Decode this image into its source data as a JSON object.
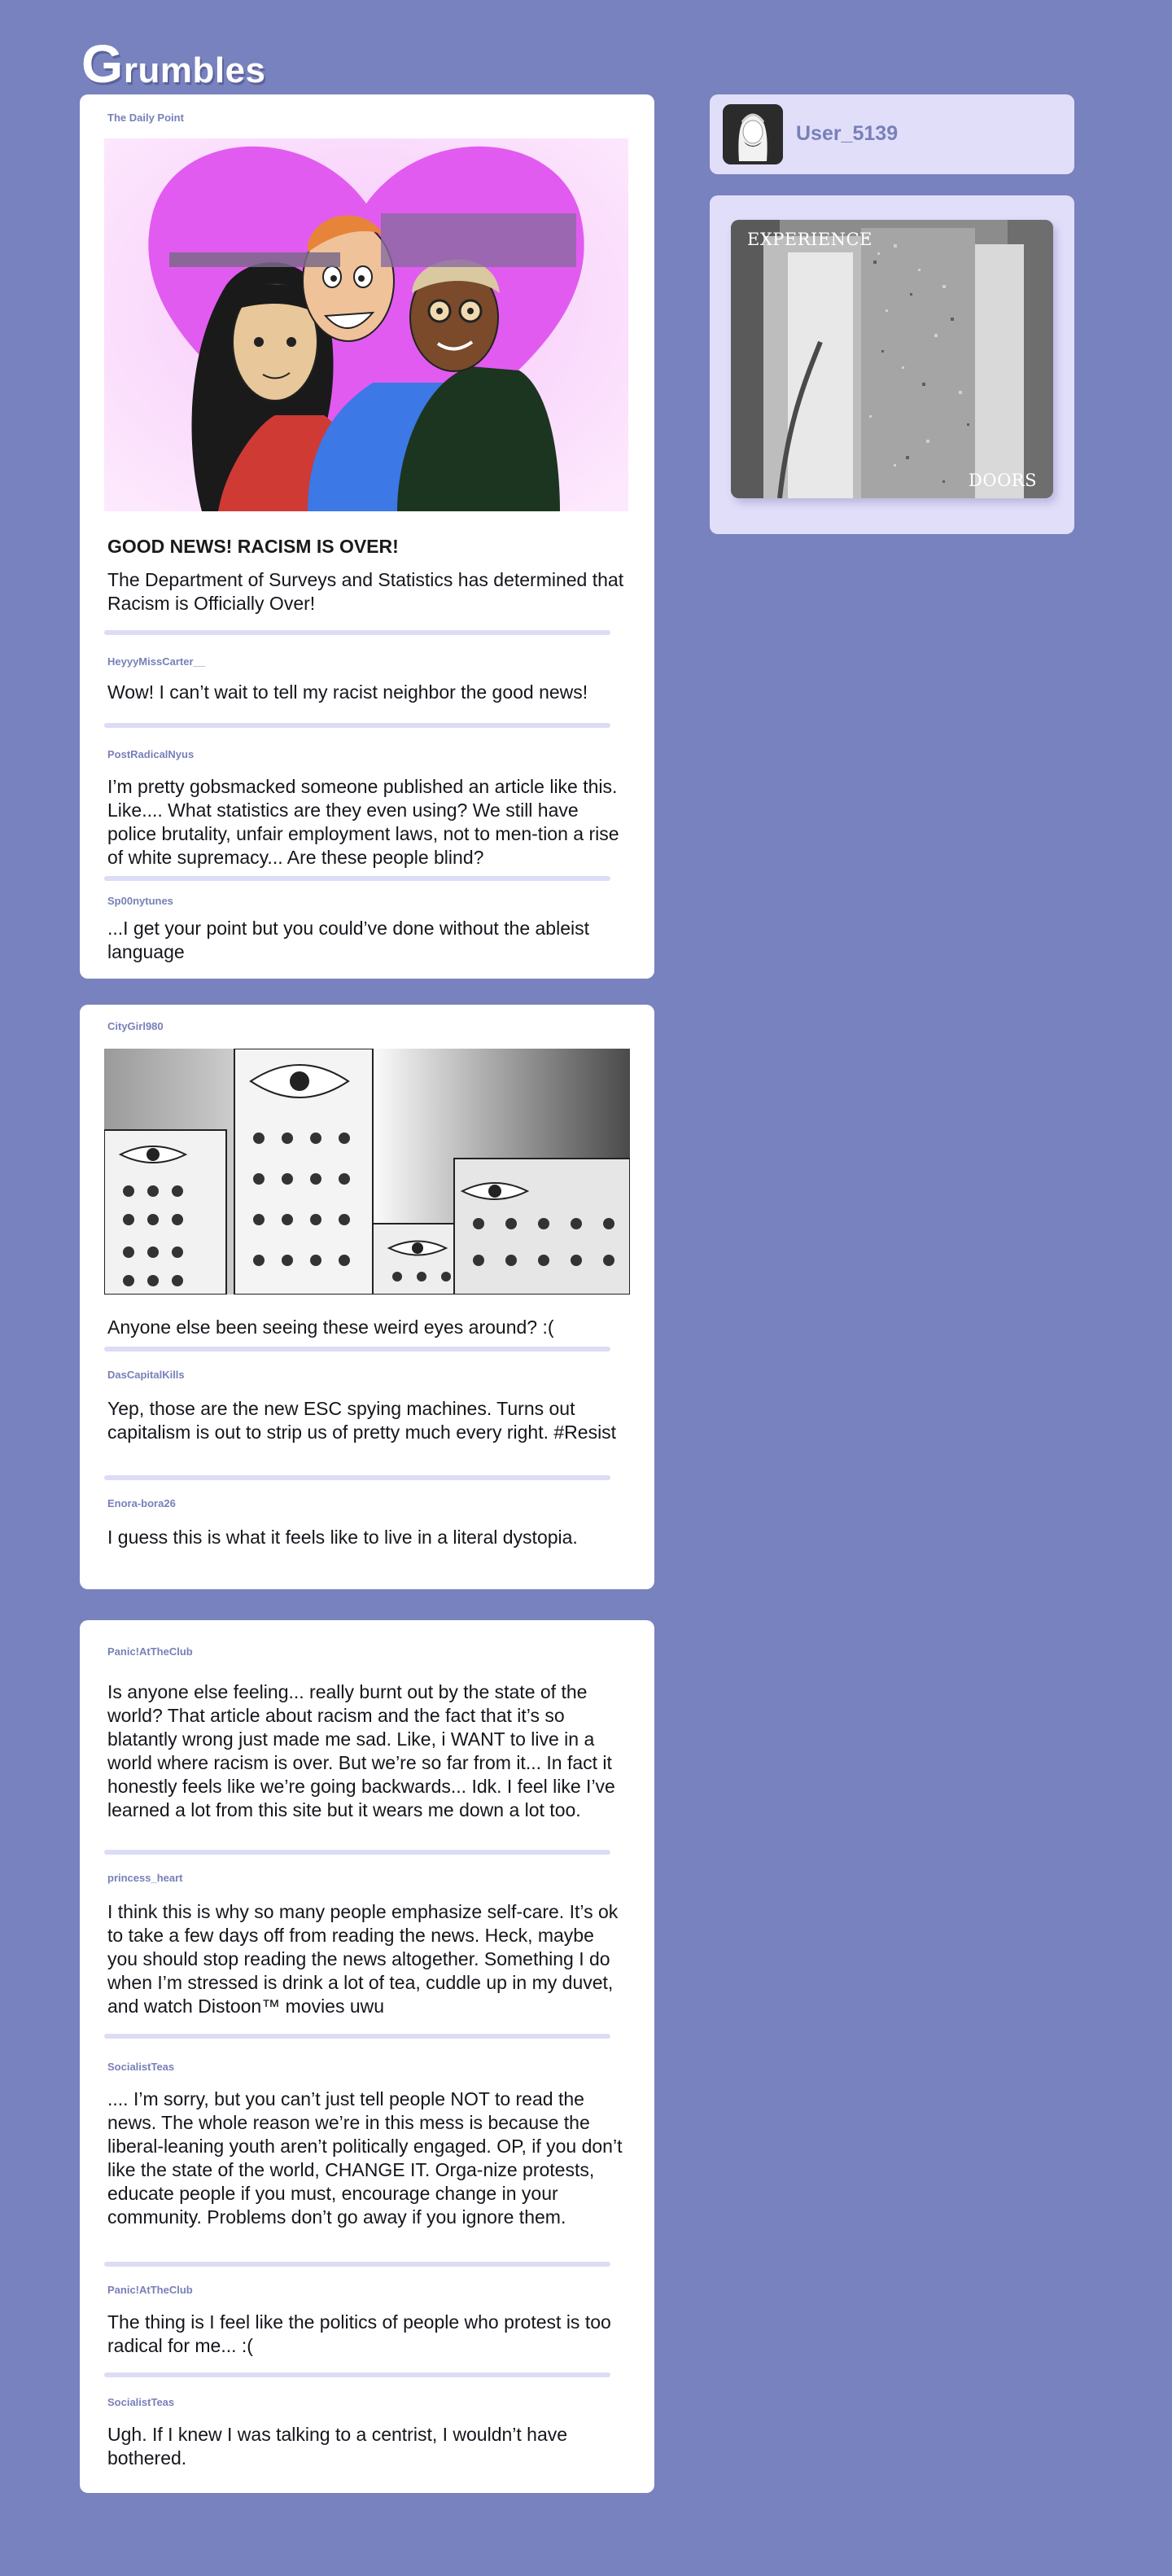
{
  "app": {
    "logo_initial": "G",
    "logo_rest": "rumbles"
  },
  "profile": {
    "username": "User_5139",
    "avatar_icon": "avatar-icon"
  },
  "ad": {
    "label_top": "EXPERIENCE",
    "label_bottom": "DOORS"
  },
  "colors": {
    "background": "#7782be",
    "card": "#ffffff",
    "panel": "#e1defa",
    "username": "#7880b8",
    "divider": "#dcdcf6"
  },
  "post1": {
    "author": "The Daily Point",
    "headline": "GOOD NEWS! RACISM IS OVER!",
    "body": "The Department of Surveys and Statistics has determined that Racism is Officially Over!",
    "comments": [
      {
        "user": "HeyyyMissCarter__",
        "text": "Wow! I can’t wait to tell my racist neighbor the good news!"
      },
      {
        "user": "PostRadicalNyus",
        "text": "I’m pretty gobsmacked someone published an article like this. Like.... What statistics are they even using? We still have police brutality, unfair employment laws, not to men-tion a rise of white supremacy... Are these people blind?"
      },
      {
        "user": "Sp00nytunes",
        "text": "...I get your point but you could’ve done without the ableist language"
      }
    ]
  },
  "post2": {
    "author": "CityGirl980",
    "body": "Anyone else been seeing these weird eyes around? :(",
    "comments": [
      {
        "user": "DasCapitalKills",
        "text": "Yep, those are the new ESC spying machines. Turns out capitalism is out to strip us of pretty much every right. #Resist"
      },
      {
        "user": "Enora-bora26",
        "text": "I guess this is what it feels like to live in a literal dystopia."
      }
    ]
  },
  "post3": {
    "author": "Panic!AtTheClub",
    "body": "Is anyone else feeling... really burnt out by the state of the world? That article about racism and the fact that it’s so blatantly wrong just made me sad. Like, i WANT to live in a world where racism is over. But we’re so far from it... In fact it honestly feels like we’re going backwards... Idk. I feel like I’ve learned a lot from this site but it wears me down a lot too.",
    "comments": [
      {
        "user": "princess_heart",
        "text": "I think this is why so many people emphasize self-care. It’s ok to take a few days off from reading the news. Heck, maybe you should stop reading the news altogether. Something I do when I’m stressed is drink a lot of tea, cuddle up in my duvet, and watch Distoon™ movies uwu"
      },
      {
        "user": "SocialistTeas",
        "text": ".... I’m sorry, but you can’t just tell people NOT to read the news. The whole reason we’re in this mess is because the liberal-leaning youth aren’t politically engaged. OP, if you don’t like the state of the world, CHANGE IT. Orga-nize protests, educate people if you must, encourage change in your community. Problems don’t go away if you ignore them."
      },
      {
        "user": "Panic!AtTheClub",
        "text": "The thing is I feel like the politics of people who protest is too radical for me... :("
      },
      {
        "user": "SocialistTeas",
        "text": "Ugh. If I knew I was talking to a centrist, I wouldn’t have bothered."
      }
    ]
  }
}
